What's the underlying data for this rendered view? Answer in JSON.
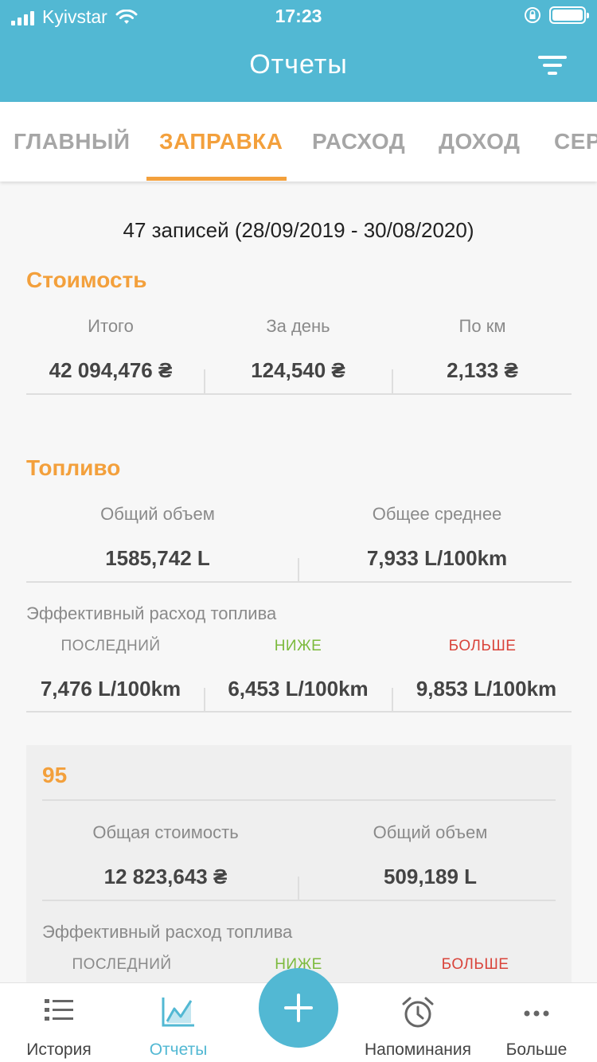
{
  "status_bar": {
    "carrier": "Kyivstar",
    "time": "17:23"
  },
  "header": {
    "title": "Отчеты"
  },
  "tabs": [
    {
      "label": "ГЛАВНЫЙ",
      "active": false
    },
    {
      "label": "ЗАПРАВКА",
      "active": true
    },
    {
      "label": "РАСХОД",
      "active": false
    },
    {
      "label": "ДОХОД",
      "active": false
    },
    {
      "label": "СЕР",
      "active": false
    }
  ],
  "summary": {
    "range": "47 записей (28/09/2019 - 30/08/2020)"
  },
  "cost": {
    "title": "Стоимость",
    "columns": [
      {
        "label": "Итого",
        "value": "42 094,476 ₴"
      },
      {
        "label": "За день",
        "value": "124,540 ₴"
      },
      {
        "label": "По км",
        "value": "2,133 ₴"
      }
    ]
  },
  "fuel": {
    "title": "Топливо",
    "columns": [
      {
        "label": "Общий объем",
        "value": "1585,742 L"
      },
      {
        "label": "Общее среднее",
        "value": "7,933 L/100km"
      }
    ],
    "efficiency": {
      "label": "Эффективный расход топлива",
      "columns": [
        {
          "label": "ПОСЛЕДНИЙ",
          "value": "7,476 L/100km"
        },
        {
          "label": "НИЖЕ",
          "value": "6,453 L/100km"
        },
        {
          "label": "БОЛЬШЕ",
          "value": "9,853 L/100km"
        }
      ]
    }
  },
  "fuel_type_card": {
    "title": "95",
    "columns": [
      {
        "label": "Общая стоимость",
        "value": "12 823,643 ₴"
      },
      {
        "label": "Общий объем",
        "value": "509,189 L"
      }
    ],
    "efficiency": {
      "label": "Эффективный расход топлива",
      "columns": [
        {
          "label": "ПОСЛЕДНИЙ"
        },
        {
          "label": "НИЖЕ"
        },
        {
          "label": "БОЛЬШЕ"
        }
      ]
    }
  },
  "bottom_nav": {
    "history": "История",
    "reports": "Отчеты",
    "reminders": "Напоминания",
    "more": "Больше"
  },
  "colors": {
    "primary": "#52b8d3",
    "accent": "#f3a03c",
    "lower": "#7cba3d",
    "higher": "#d9443b"
  }
}
